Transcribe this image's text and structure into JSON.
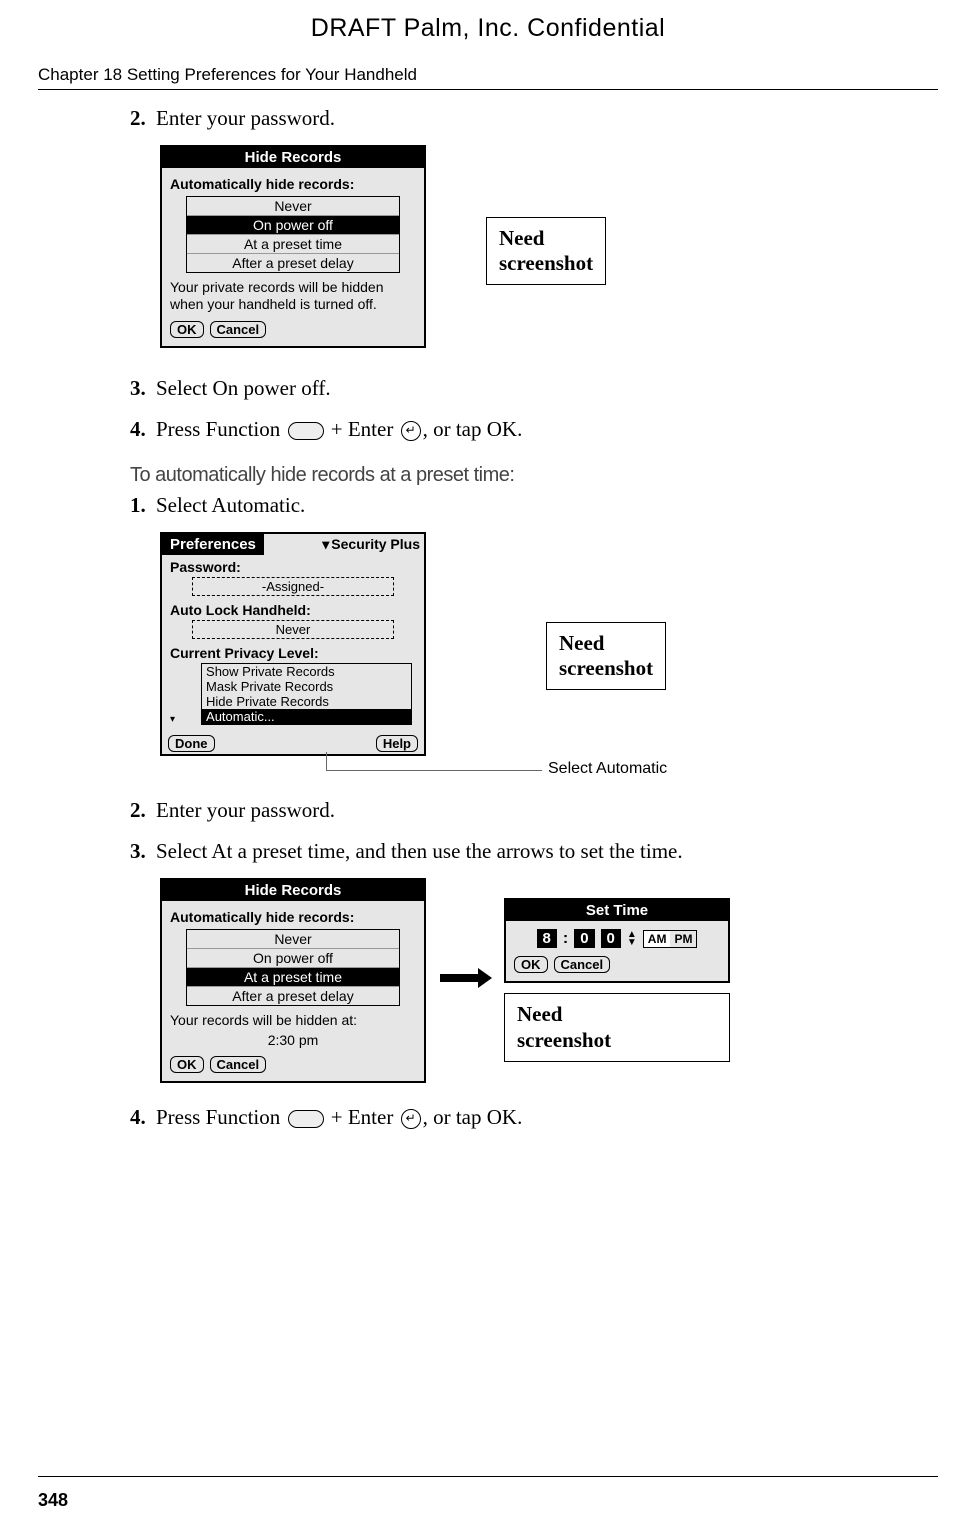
{
  "watermark": "DRAFT   Palm, Inc. Confidential",
  "header": "Chapter 18   Setting Preferences for Your Handheld",
  "page_num": "348",
  "need_box": "Need\nscreenshot",
  "steps": {
    "s2": {
      "num": "2.",
      "text": "Enter your password."
    },
    "s3": {
      "num": "3.",
      "text": "Select On power off."
    },
    "s4_a": "Press Function",
    "s4_b": "+ Enter",
    "s4_c": ", or tap OK.",
    "s4_num": "4.",
    "b1": {
      "num": "1.",
      "text": "Select Automatic."
    },
    "b2": {
      "num": "2.",
      "text": "Enter your password."
    },
    "b3": {
      "num": "3.",
      "text": "Select At a preset time, and then use the arrows to set the time."
    },
    "b4_num": "4."
  },
  "subheading": "To automatically hide records at a preset time:",
  "hide1": {
    "title": "Hide Records",
    "label": "Automatically hide records:",
    "opts": [
      "Never",
      "On power off",
      "At a preset time",
      "After a preset delay"
    ],
    "selected": 1,
    "help": "Your private records will be hidden when your handheld is turned off.",
    "ok": "OK",
    "cancel": "Cancel"
  },
  "prefs": {
    "tab": "Preferences",
    "dd": "Security Plus",
    "pwd_lbl": "Password:",
    "pwd_val": "-Assigned-",
    "lock_lbl": "Auto Lock Handheld:",
    "lock_val": "Never",
    "priv_lbl": "Current Privacy Level:",
    "opts": [
      "Show Private Records",
      "Mask Private Records",
      "Hide Private Records",
      "Automatic..."
    ],
    "done": "Done",
    "help": "Help"
  },
  "annot": "Select Automatic",
  "hide2": {
    "title": "Hide Records",
    "label": "Automatically hide records:",
    "opts": [
      "Never",
      "On power off",
      "At a preset time",
      "After a preset delay"
    ],
    "selected": 2,
    "help_lbl": "Your records will be hidden at:",
    "help_time": "2:30 pm",
    "ok": "OK",
    "cancel": "Cancel"
  },
  "settime": {
    "title": "Set Time",
    "h": "8",
    "m1": "0",
    "m2": "0",
    "am": "AM",
    "pm": "PM",
    "ok": "OK",
    "cancel": "Cancel"
  }
}
